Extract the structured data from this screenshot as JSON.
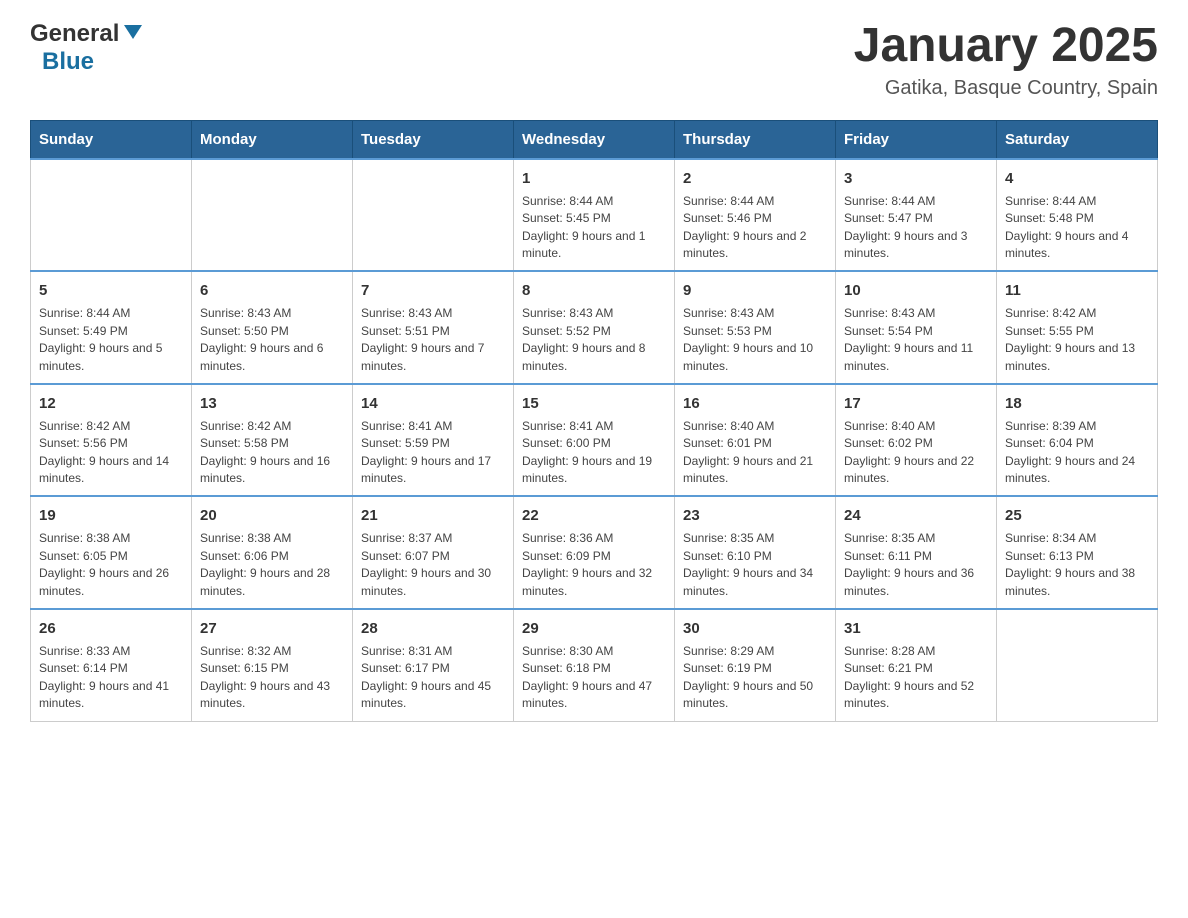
{
  "header": {
    "logo": {
      "general": "General",
      "blue": "Blue"
    },
    "title": "January 2025",
    "location": "Gatika, Basque Country, Spain"
  },
  "calendar": {
    "days": [
      "Sunday",
      "Monday",
      "Tuesday",
      "Wednesday",
      "Thursday",
      "Friday",
      "Saturday"
    ],
    "weeks": [
      [
        {
          "day": "",
          "info": ""
        },
        {
          "day": "",
          "info": ""
        },
        {
          "day": "",
          "info": ""
        },
        {
          "day": "1",
          "info": "Sunrise: 8:44 AM\nSunset: 5:45 PM\nDaylight: 9 hours and 1 minute."
        },
        {
          "day": "2",
          "info": "Sunrise: 8:44 AM\nSunset: 5:46 PM\nDaylight: 9 hours and 2 minutes."
        },
        {
          "day": "3",
          "info": "Sunrise: 8:44 AM\nSunset: 5:47 PM\nDaylight: 9 hours and 3 minutes."
        },
        {
          "day": "4",
          "info": "Sunrise: 8:44 AM\nSunset: 5:48 PM\nDaylight: 9 hours and 4 minutes."
        }
      ],
      [
        {
          "day": "5",
          "info": "Sunrise: 8:44 AM\nSunset: 5:49 PM\nDaylight: 9 hours and 5 minutes."
        },
        {
          "day": "6",
          "info": "Sunrise: 8:43 AM\nSunset: 5:50 PM\nDaylight: 9 hours and 6 minutes."
        },
        {
          "day": "7",
          "info": "Sunrise: 8:43 AM\nSunset: 5:51 PM\nDaylight: 9 hours and 7 minutes."
        },
        {
          "day": "8",
          "info": "Sunrise: 8:43 AM\nSunset: 5:52 PM\nDaylight: 9 hours and 8 minutes."
        },
        {
          "day": "9",
          "info": "Sunrise: 8:43 AM\nSunset: 5:53 PM\nDaylight: 9 hours and 10 minutes."
        },
        {
          "day": "10",
          "info": "Sunrise: 8:43 AM\nSunset: 5:54 PM\nDaylight: 9 hours and 11 minutes."
        },
        {
          "day": "11",
          "info": "Sunrise: 8:42 AM\nSunset: 5:55 PM\nDaylight: 9 hours and 13 minutes."
        }
      ],
      [
        {
          "day": "12",
          "info": "Sunrise: 8:42 AM\nSunset: 5:56 PM\nDaylight: 9 hours and 14 minutes."
        },
        {
          "day": "13",
          "info": "Sunrise: 8:42 AM\nSunset: 5:58 PM\nDaylight: 9 hours and 16 minutes."
        },
        {
          "day": "14",
          "info": "Sunrise: 8:41 AM\nSunset: 5:59 PM\nDaylight: 9 hours and 17 minutes."
        },
        {
          "day": "15",
          "info": "Sunrise: 8:41 AM\nSunset: 6:00 PM\nDaylight: 9 hours and 19 minutes."
        },
        {
          "day": "16",
          "info": "Sunrise: 8:40 AM\nSunset: 6:01 PM\nDaylight: 9 hours and 21 minutes."
        },
        {
          "day": "17",
          "info": "Sunrise: 8:40 AM\nSunset: 6:02 PM\nDaylight: 9 hours and 22 minutes."
        },
        {
          "day": "18",
          "info": "Sunrise: 8:39 AM\nSunset: 6:04 PM\nDaylight: 9 hours and 24 minutes."
        }
      ],
      [
        {
          "day": "19",
          "info": "Sunrise: 8:38 AM\nSunset: 6:05 PM\nDaylight: 9 hours and 26 minutes."
        },
        {
          "day": "20",
          "info": "Sunrise: 8:38 AM\nSunset: 6:06 PM\nDaylight: 9 hours and 28 minutes."
        },
        {
          "day": "21",
          "info": "Sunrise: 8:37 AM\nSunset: 6:07 PM\nDaylight: 9 hours and 30 minutes."
        },
        {
          "day": "22",
          "info": "Sunrise: 8:36 AM\nSunset: 6:09 PM\nDaylight: 9 hours and 32 minutes."
        },
        {
          "day": "23",
          "info": "Sunrise: 8:35 AM\nSunset: 6:10 PM\nDaylight: 9 hours and 34 minutes."
        },
        {
          "day": "24",
          "info": "Sunrise: 8:35 AM\nSunset: 6:11 PM\nDaylight: 9 hours and 36 minutes."
        },
        {
          "day": "25",
          "info": "Sunrise: 8:34 AM\nSunset: 6:13 PM\nDaylight: 9 hours and 38 minutes."
        }
      ],
      [
        {
          "day": "26",
          "info": "Sunrise: 8:33 AM\nSunset: 6:14 PM\nDaylight: 9 hours and 41 minutes."
        },
        {
          "day": "27",
          "info": "Sunrise: 8:32 AM\nSunset: 6:15 PM\nDaylight: 9 hours and 43 minutes."
        },
        {
          "day": "28",
          "info": "Sunrise: 8:31 AM\nSunset: 6:17 PM\nDaylight: 9 hours and 45 minutes."
        },
        {
          "day": "29",
          "info": "Sunrise: 8:30 AM\nSunset: 6:18 PM\nDaylight: 9 hours and 47 minutes."
        },
        {
          "day": "30",
          "info": "Sunrise: 8:29 AM\nSunset: 6:19 PM\nDaylight: 9 hours and 50 minutes."
        },
        {
          "day": "31",
          "info": "Sunrise: 8:28 AM\nSunset: 6:21 PM\nDaylight: 9 hours and 52 minutes."
        },
        {
          "day": "",
          "info": ""
        }
      ]
    ]
  }
}
